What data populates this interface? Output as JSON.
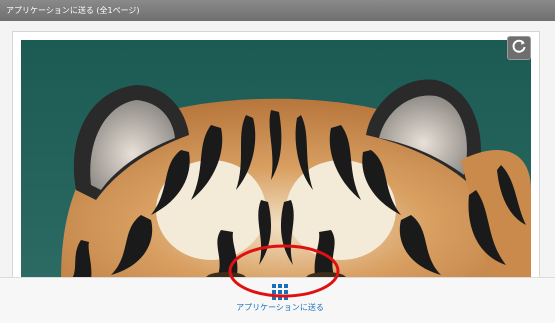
{
  "window": {
    "title": "アプリケーションに送る (全1ページ)"
  },
  "preview": {
    "image_name": "tiger-photo",
    "rotate_icon": "rotate-icon"
  },
  "toolbar": {
    "send_label": "アプリケーションに送る",
    "send_icon": "grid-apps-icon"
  },
  "colors": {
    "title_bar": "#7d7d7d",
    "accent": "#1b6fb8",
    "highlight": "#e01010"
  }
}
